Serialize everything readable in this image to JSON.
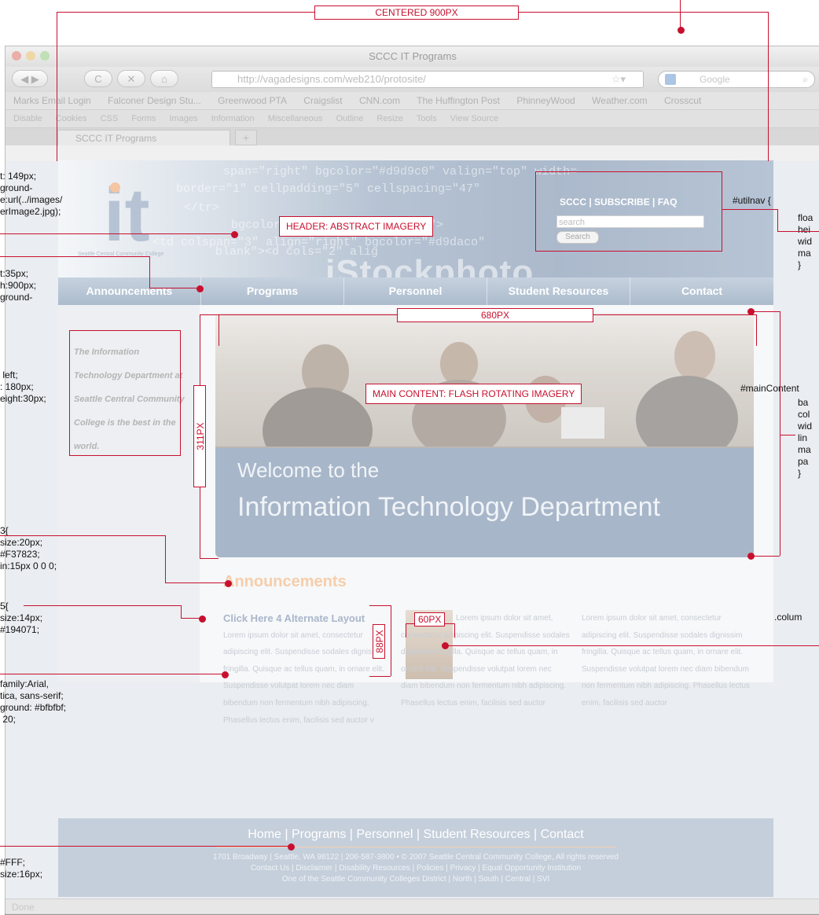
{
  "browser": {
    "window_title": "SCCC IT Programs",
    "url": "http://vagadesigns.com/web210/protosite/",
    "search_placeholder": "Google",
    "bookmarks": [
      "Marks Email Login",
      "Falconer Design Stu...",
      "Greenwood PTA",
      "Craigslist",
      "CNN.com",
      "The Huffington Post",
      "PhinneyWood",
      "Weather.com",
      "Crosscut"
    ],
    "dev_toolbar": [
      "Disable",
      "Cookies",
      "CSS",
      "Forms",
      "Images",
      "Information",
      "Miscellaneous",
      "Outline",
      "Resize",
      "Tools",
      "View Source"
    ],
    "tab_title": "SCCC IT Programs",
    "status": "Done"
  },
  "site": {
    "logo_text": "it",
    "logo_subtitle": "Seattle Central Community College",
    "header_code_1": "span=\"right\" bgcolor=\"#d9d9c0\" valign=\"top\" width=",
    "header_code_2": "border=\"1\" cellpadding=\"5\" cellspacing=\"47\"",
    "header_code_3": "</tr>",
    "header_code_4": "bgcolor=\"#d9daco\" height=\"60\">",
    "header_code_5": "<td colspan=\"3\" align=\"right\" bgcolor=\"#d9daco\"",
    "header_code_6": "blank\"><d cols=\"2\" alig",
    "watermark": "iStockphoto",
    "utilnav_links": "SCCC | SUBSCRIBE | FAQ",
    "search_placeholder": "search",
    "search_button": "Search",
    "nav": [
      "Announcements",
      "Programs",
      "Personnel",
      "Student Resources",
      "Contact"
    ],
    "tagline": "The Information Technology Department at Seattle Central Community College is the best in the world.",
    "welcome_line1": "Welcome to the",
    "welcome_line2": "Information Technology Department",
    "announcements_heading": "Announcements",
    "alt_layout_link": "Click Here 4 Alternate Layout",
    "col1_text": "Lorem ipsum dolor sit amet, consectetur adipiscing elit. Suspendisse sodales dignissim fringilla. Quisque ac tellus quam, in ornare elit. Suspendisse volutpat lorem nec diam bibendum non fermentum nibh adipiscing. Phasellus lectus enim, facilisis sed auctor v",
    "col2_text": "Lorem ipsum dolor sit amet, consectetur adipiscing elit. Suspendisse sodales dignissim fringilla. Quisque ac tellus quam, in ornare elit. Suspendisse volutpat lorem nec diam bibendum non fermentum nibh adipiscing. Phasellus lectus enim, facilisis sed auctor",
    "col3_text": "Lorem ipsum dolor sit amet, consectetur adipiscing elit. Suspendisse sodales dignissim fringilla. Quisque ac tellus quam, in ornare elit. Suspendisse volutpat lorem nec diam bibendum non fermentum nibh adipiscing. Phasellus lectus enim, facilisis sed auctor",
    "footer_nav": "Home | Programs | Personnel | Student Resources | Contact",
    "footer_line1": "1701 Broadway | Seattle, WA 98122 | 206-587-3800 • © 2007 Seattle Central Community College, All rights reserved",
    "footer_line2": "Contact Us | Disclaimer | Disability Resources | Policies | Privacy | Equal Opportunity Institution",
    "footer_line3": "One of the Seattle Community Colleges District | North | South | Central | SVI"
  },
  "annotations": {
    "centered_label": "CENTERED 900PX",
    "header_label": "HEADER: ABSTRACT IMAGERY",
    "main_label": "MAIN CONTENT: FLASH ROTATING IMAGERY",
    "width_680": "680PX",
    "height_311": "311PX",
    "width_60": "60PX",
    "height_88": "88PX",
    "left_header_css": "t: 149px;\nground-\ne:url(../images/\nerImage2.jpg);",
    "left_nav_css": "t:35px;\nh:900px;\nground-",
    "left_col_css": " left;\n: 180px;\neight:30px;",
    "left_h3_css": "3{\nsize:20px;\n#F37823;\nin:15px 0 0 0;",
    "left_h5_css": "5{\nsize:14px;\n#194071;",
    "left_body_css": "family:Arial,\ntica, sans-serif;\nground: #bfbfbf;\n 20;",
    "left_footer_css": "#FFF;\nsize:16px;",
    "utilnav_css": "#utilnav {",
    "utilnav_props": "floa\nhei\nwid\nma\n}",
    "maincontent_css": "#mainContent",
    "maincontent_props": "ba\ncol\nwid\nlin\nma\npa\n}",
    "column_css": ".colum"
  },
  "colors": {
    "annotation_red": "#c8102e",
    "h3_orange": "#F37823",
    "h5_blue": "#194071"
  }
}
